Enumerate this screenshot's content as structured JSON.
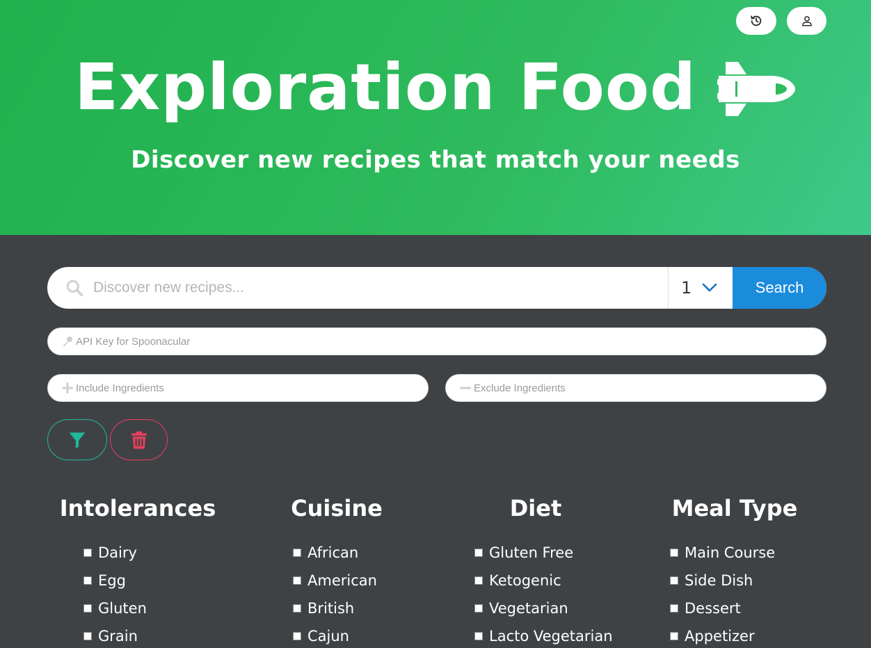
{
  "hero": {
    "title": "Exploration Food",
    "subtitle": "Discover new recipes that match your needs"
  },
  "top_buttons": {
    "history_icon": "history-icon",
    "account_icon": "user-icon"
  },
  "search": {
    "placeholder": "Discover new recipes...",
    "page_value": "1",
    "button_label": "Search"
  },
  "api_key": {
    "placeholder": "API Key for Spoonacular"
  },
  "ingredients": {
    "include_placeholder": "Include Ingredients",
    "exclude_placeholder": "Exclude Ingredients"
  },
  "actions": {
    "filter_icon": "filter-icon",
    "clear_icon": "trash-icon"
  },
  "filters": {
    "intolerances": {
      "title": "Intolerances",
      "items": [
        "Dairy",
        "Egg",
        "Gluten",
        "Grain"
      ]
    },
    "cuisine": {
      "title": "Cuisine",
      "items": [
        "African",
        "American",
        "British",
        "Cajun"
      ]
    },
    "diet": {
      "title": "Diet",
      "items": [
        "Gluten Free",
        "Ketogenic",
        "Vegetarian",
        "Lacto Vegetarian"
      ]
    },
    "meal_type": {
      "title": "Meal Type",
      "items": [
        "Main Course",
        "Side Dish",
        "Dessert",
        "Appetizer"
      ]
    }
  },
  "colors": {
    "hero_green": "#2fbb5e",
    "background": "#3f4245",
    "search_blue": "#1b8bdc",
    "filter_teal": "#1fb89a",
    "clear_red": "#e5405d"
  }
}
